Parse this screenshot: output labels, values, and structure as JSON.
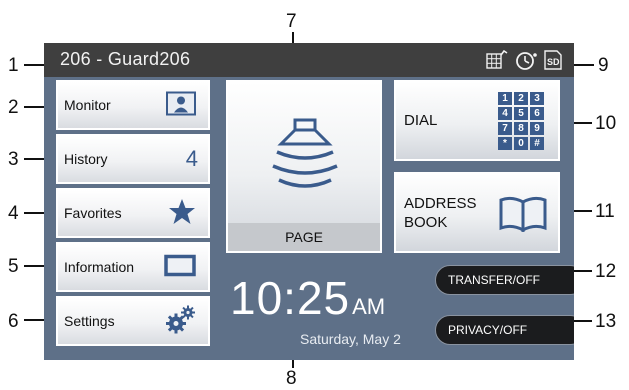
{
  "callouts": [
    "1",
    "2",
    "3",
    "4",
    "5",
    "6",
    "7",
    "8",
    "9",
    "10",
    "11",
    "12",
    "13"
  ],
  "status_bar": {
    "title": "206 - Guard206",
    "icons": [
      "grid-phone-icon",
      "timer-icon",
      "sd-card-icon"
    ],
    "sd_label": "SD"
  },
  "left_menu": {
    "monitor": "Monitor",
    "history": "History",
    "history_count": "4",
    "favorites": "Favorites",
    "information": "Information",
    "settings": "Settings"
  },
  "page_button": {
    "label": "PAGE"
  },
  "dial_button": {
    "label": "DIAL",
    "keys": [
      "1",
      "2",
      "3",
      "4",
      "5",
      "6",
      "7",
      "8",
      "9",
      "*",
      "0",
      "#"
    ]
  },
  "address_book_button": {
    "label_line1": "ADDRESS",
    "label_line2": "BOOK"
  },
  "clock": {
    "time": "10:25",
    "ampm": "AM",
    "date": "Saturday, May 2"
  },
  "pills": {
    "transfer": "TRANSFER/OFF",
    "privacy": "PRIVACY/OFF"
  },
  "colors": {
    "screen_bg": "#5e7088",
    "status_bar": "#3f3f3f",
    "pill_bg": "#1b1c1e",
    "page_bar": "#c5c8cc"
  }
}
